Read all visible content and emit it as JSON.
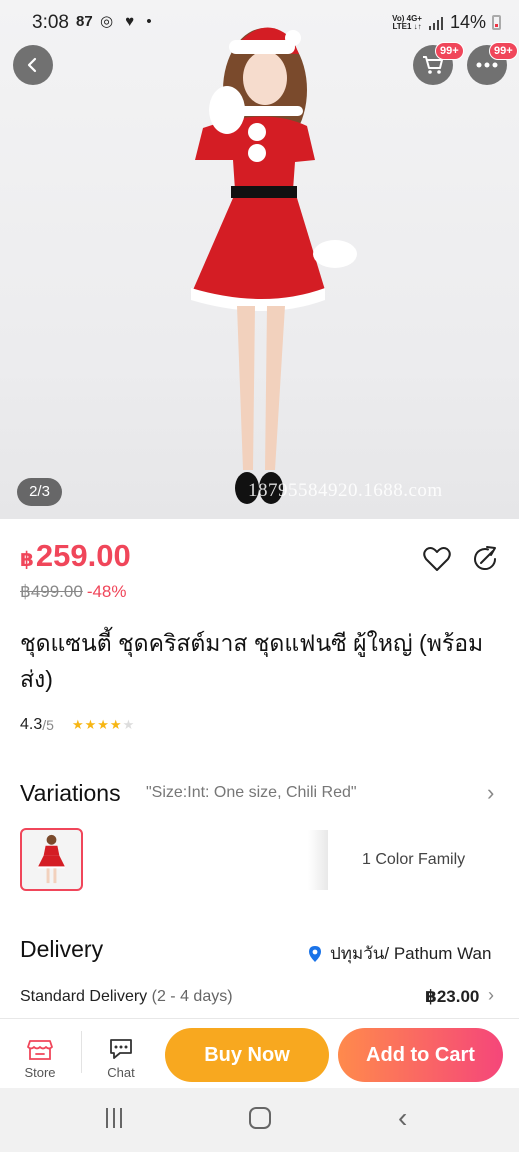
{
  "status_bar": {
    "time": "3:08",
    "notif_count": "87",
    "icons": "◎ ♥ •",
    "network": "Vo) 4G+",
    "network_sub": "LTE1 ↓↑",
    "battery": "14%"
  },
  "hero": {
    "image_counter": "2/3",
    "watermark": "18795584920.1688.com",
    "cart_badge": "99+",
    "more_badge": "99+"
  },
  "product": {
    "currency": "฿",
    "price": "259.00",
    "original_price": "฿499.00",
    "discount": "-48%",
    "title": "ชุดแซนตี้ ชุดคริสต์มาส ชุดแฟนซี ผู้ใหญ่ (พร้อมส่ง)",
    "rating": "4.3",
    "rating_denominator": "/5",
    "rating_value": 4.3
  },
  "variations": {
    "label": "Variations",
    "selected": "\"Size:Int: One size, Chili Red\"",
    "color_family": "1 Color Family"
  },
  "delivery": {
    "label": "Delivery",
    "location": "ปทุมวัน/ Pathum Wan",
    "standard_label": "Standard Delivery",
    "standard_days": "(2 - 4 days)",
    "standard_price": "฿23.00"
  },
  "action_bar": {
    "store_label": "Store",
    "chat_label": "Chat",
    "buy_now": "Buy Now",
    "add_to_cart": "Add to Cart"
  },
  "colors": {
    "accent_red": "#f0465a",
    "buy_now": "#f8a81f",
    "add_cart_gradient": [
      "#ff8a4c",
      "#f5467a"
    ],
    "star": "#f7b614"
  }
}
